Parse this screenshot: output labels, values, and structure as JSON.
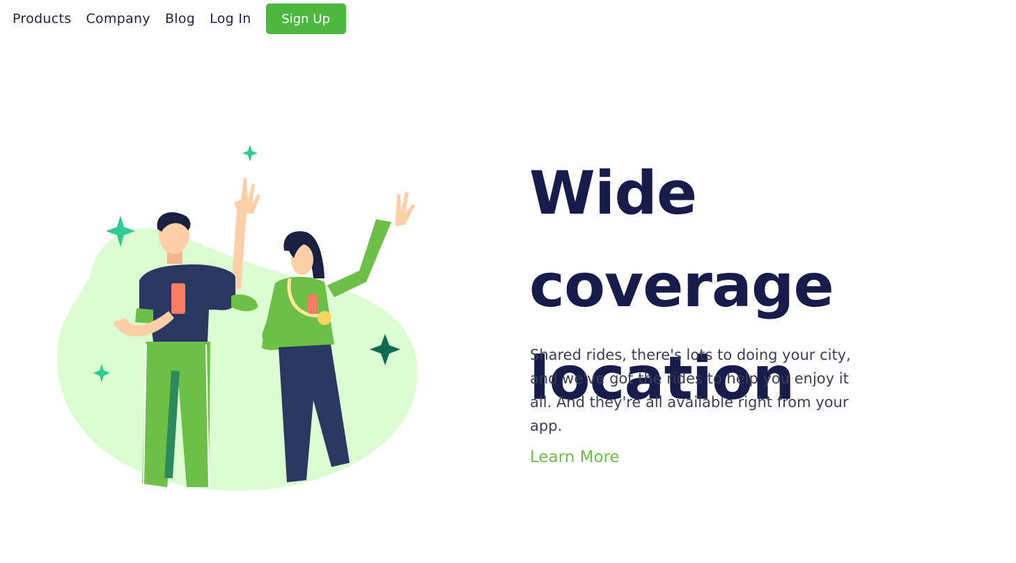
{
  "nav": {
    "links": [
      "Products",
      "Company",
      "Blog",
      "Log In"
    ],
    "signup_label": "Sign Up"
  },
  "hero": {
    "title_line1": "Wide coverage",
    "title_line2": "location",
    "description": "Shared rides, there's lots to doing your city, and we've got the rides to help you enjoy it all. And they're all available right from your app.",
    "link_label": "Learn More"
  },
  "colors": {
    "accent": "#4cb83f",
    "title": "#171c4a",
    "link": "#6cbf47",
    "blob": "#dcfcd2"
  },
  "illustration": {
    "icons": [
      "sparkle-icon",
      "phone-icon",
      "medal-icon"
    ]
  }
}
